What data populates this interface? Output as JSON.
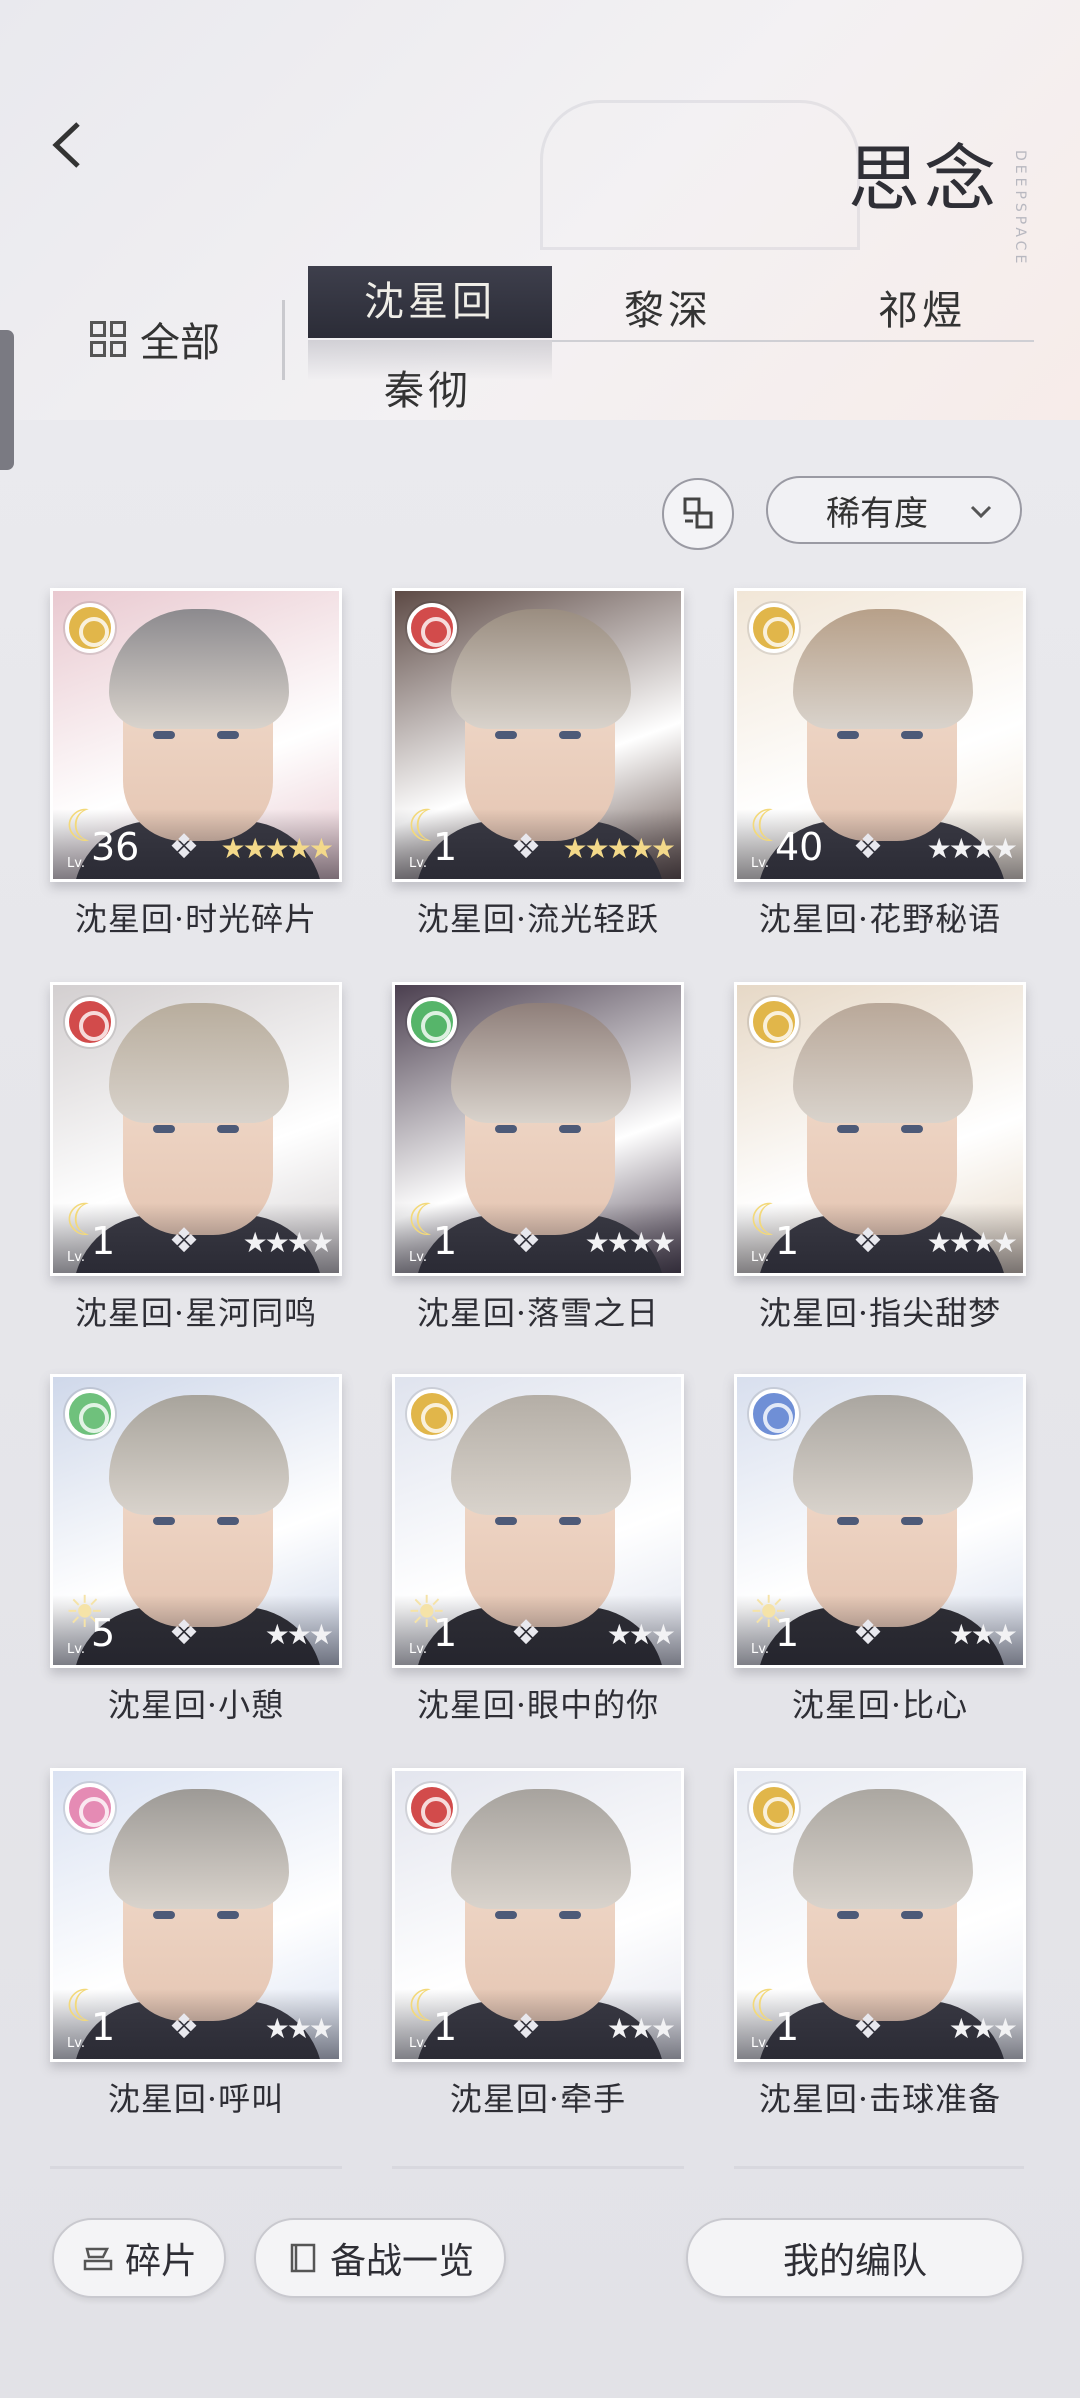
{
  "header": {
    "title": "思念",
    "brand": "DEEPSPACE",
    "back_icon": "chevron-left-icon"
  },
  "filters": {
    "all_label": "全部",
    "tabs": [
      {
        "label": "沈星回",
        "active": true
      },
      {
        "label": "黎深",
        "active": false
      },
      {
        "label": "祁煜",
        "active": false
      },
      {
        "label": "秦彻",
        "active": false
      }
    ]
  },
  "sort": {
    "toggle_icon": "sort-toggle-icon",
    "label": "稀有度"
  },
  "cards": [
    {
      "name": "沈星回·时光碎片",
      "level": "36",
      "lv_label": "Lv.",
      "stars": "★★★★★",
      "badge_color": "#e1b64a",
      "level_icon": "moon",
      "hair": "#8c8a8e",
      "bg": "#e9c9d0"
    },
    {
      "name": "沈星回·流光轻跃",
      "level": "1",
      "lv_label": "Lv.",
      "stars": "★★★★★",
      "badge_color": "#d24b4b",
      "level_icon": "moon",
      "hair": "#9a8d80",
      "bg": "#5d4a45"
    },
    {
      "name": "沈星回·花野秘语",
      "level": "40",
      "lv_label": "Lv.",
      "stars": "★★★★",
      "badge_color": "#e1b64a",
      "level_icon": "moon",
      "hair": "#b7a089",
      "bg": "#f1e6d7"
    },
    {
      "name": "沈星回·星河同鸣",
      "level": "1",
      "lv_label": "Lv.",
      "stars": "★★★★",
      "badge_color": "#d24b4b",
      "level_icon": "moon",
      "hair": "#b8ad9d",
      "bg": "#d3cfd0"
    },
    {
      "name": "沈星回·落雪之日",
      "level": "1",
      "lv_label": "Lv.",
      "stars": "★★★★",
      "badge_color": "#56b56a",
      "level_icon": "moon",
      "hair": "#8f7f7a",
      "bg": "#4b3f4f"
    },
    {
      "name": "沈星回·指尖甜梦",
      "level": "1",
      "lv_label": "Lv.",
      "stars": "★★★★",
      "badge_color": "#e1b64a",
      "level_icon": "moon",
      "hair": "#b9a899",
      "bg": "#e6d8c6"
    },
    {
      "name": "沈星回·小憩",
      "level": "5",
      "lv_label": "Lv.",
      "stars": "★★★",
      "badge_color": "#6fc17c",
      "level_icon": "sun",
      "hair": "#a8a49c",
      "bg": "#cfd8ea"
    },
    {
      "name": "沈星回·眼中的你",
      "level": "1",
      "lv_label": "Lv.",
      "stars": "★★★",
      "badge_color": "#e1b64a",
      "level_icon": "sun",
      "hair": "#b4aea6",
      "bg": "#dfe3ee"
    },
    {
      "name": "沈星回·比心",
      "level": "1",
      "lv_label": "Lv.",
      "stars": "★★★",
      "badge_color": "#6f8fd6",
      "level_icon": "sun",
      "hair": "#aaa6a0",
      "bg": "#d8dfee"
    },
    {
      "name": "沈星回·呼叫",
      "level": "1",
      "lv_label": "Lv.",
      "stars": "★★★",
      "badge_color": "#e58bb4",
      "level_icon": "moon",
      "hair": "#9d9a96",
      "bg": "#dae2f2"
    },
    {
      "name": "沈星回·牵手",
      "level": "1",
      "lv_label": "Lv.",
      "stars": "★★★",
      "badge_color": "#d24b4b",
      "level_icon": "moon",
      "hair": "#a7a39e",
      "bg": "#e3e5ee"
    },
    {
      "name": "沈星回·击球准备",
      "level": "1",
      "lv_label": "Lv.",
      "stars": "★★★",
      "badge_color": "#e1b64a",
      "level_icon": "moon",
      "hair": "#aba7a1",
      "bg": "#e7eaf2"
    }
  ],
  "footer": {
    "fragments_label": "碎片",
    "prep_label": "备战一览",
    "team_label": "我的编队"
  }
}
